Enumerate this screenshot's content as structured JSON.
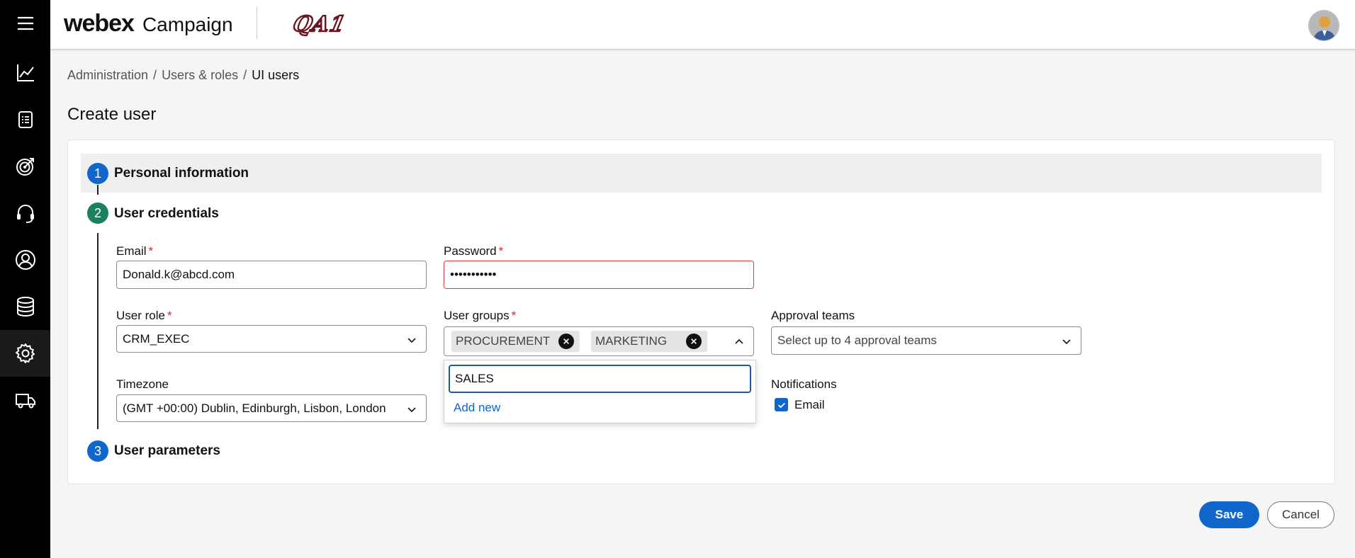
{
  "rail": {
    "items": [
      {
        "icon": "hamburger-menu-icon"
      },
      {
        "icon": "analytics-chart-icon"
      },
      {
        "icon": "document-list-icon"
      },
      {
        "icon": "target-icon"
      },
      {
        "icon": "headset-icon"
      },
      {
        "icon": "user-circle-icon"
      },
      {
        "icon": "database-icon"
      },
      {
        "icon": "gear-icon",
        "active": true
      },
      {
        "icon": "delivery-truck-icon"
      }
    ]
  },
  "header": {
    "brand_primary": "webex",
    "brand_secondary": "Campaign",
    "org_logo_text": "QA1"
  },
  "breadcrumb": {
    "items": [
      "Administration",
      "Users & roles",
      "UI users"
    ],
    "separator": "/"
  },
  "page": {
    "title": "Create user"
  },
  "steps": [
    {
      "number": "1",
      "title": "Personal information",
      "color": "#1166cc"
    },
    {
      "number": "2",
      "title": "User credentials",
      "color": "#1a8060"
    },
    {
      "number": "3",
      "title": "User parameters",
      "color": "#1166cc"
    }
  ],
  "form": {
    "email": {
      "label": "Email",
      "required_mark": "*",
      "value": "Donald.k@abcd.com"
    },
    "password": {
      "label": "Password",
      "required_mark": "*",
      "value": "•••••••••••"
    },
    "user_role": {
      "label": "User role",
      "required_mark": "*",
      "value": "CRM_EXEC"
    },
    "user_groups": {
      "label": "User groups",
      "required_mark": "*",
      "chips": [
        "PROCUREMENT",
        "MARKETING"
      ],
      "search_value": "SALES",
      "add_new_label": "Add new"
    },
    "approval_teams": {
      "label": "Approval teams",
      "placeholder": "Select up to 4 approval teams"
    },
    "timezone": {
      "label": "Timezone",
      "value": "(GMT +00:00) Dublin, Edinburgh, Lisbon, London"
    },
    "notifications": {
      "label": "Notifications",
      "option_label": "Email",
      "checked": true
    }
  },
  "actions": {
    "save_label": "Save",
    "cancel_label": "Cancel"
  },
  "colors": {
    "accent": "#1166cc",
    "step_active": "#1a8060",
    "error_border": "#d84040",
    "required": "#dd2222"
  }
}
